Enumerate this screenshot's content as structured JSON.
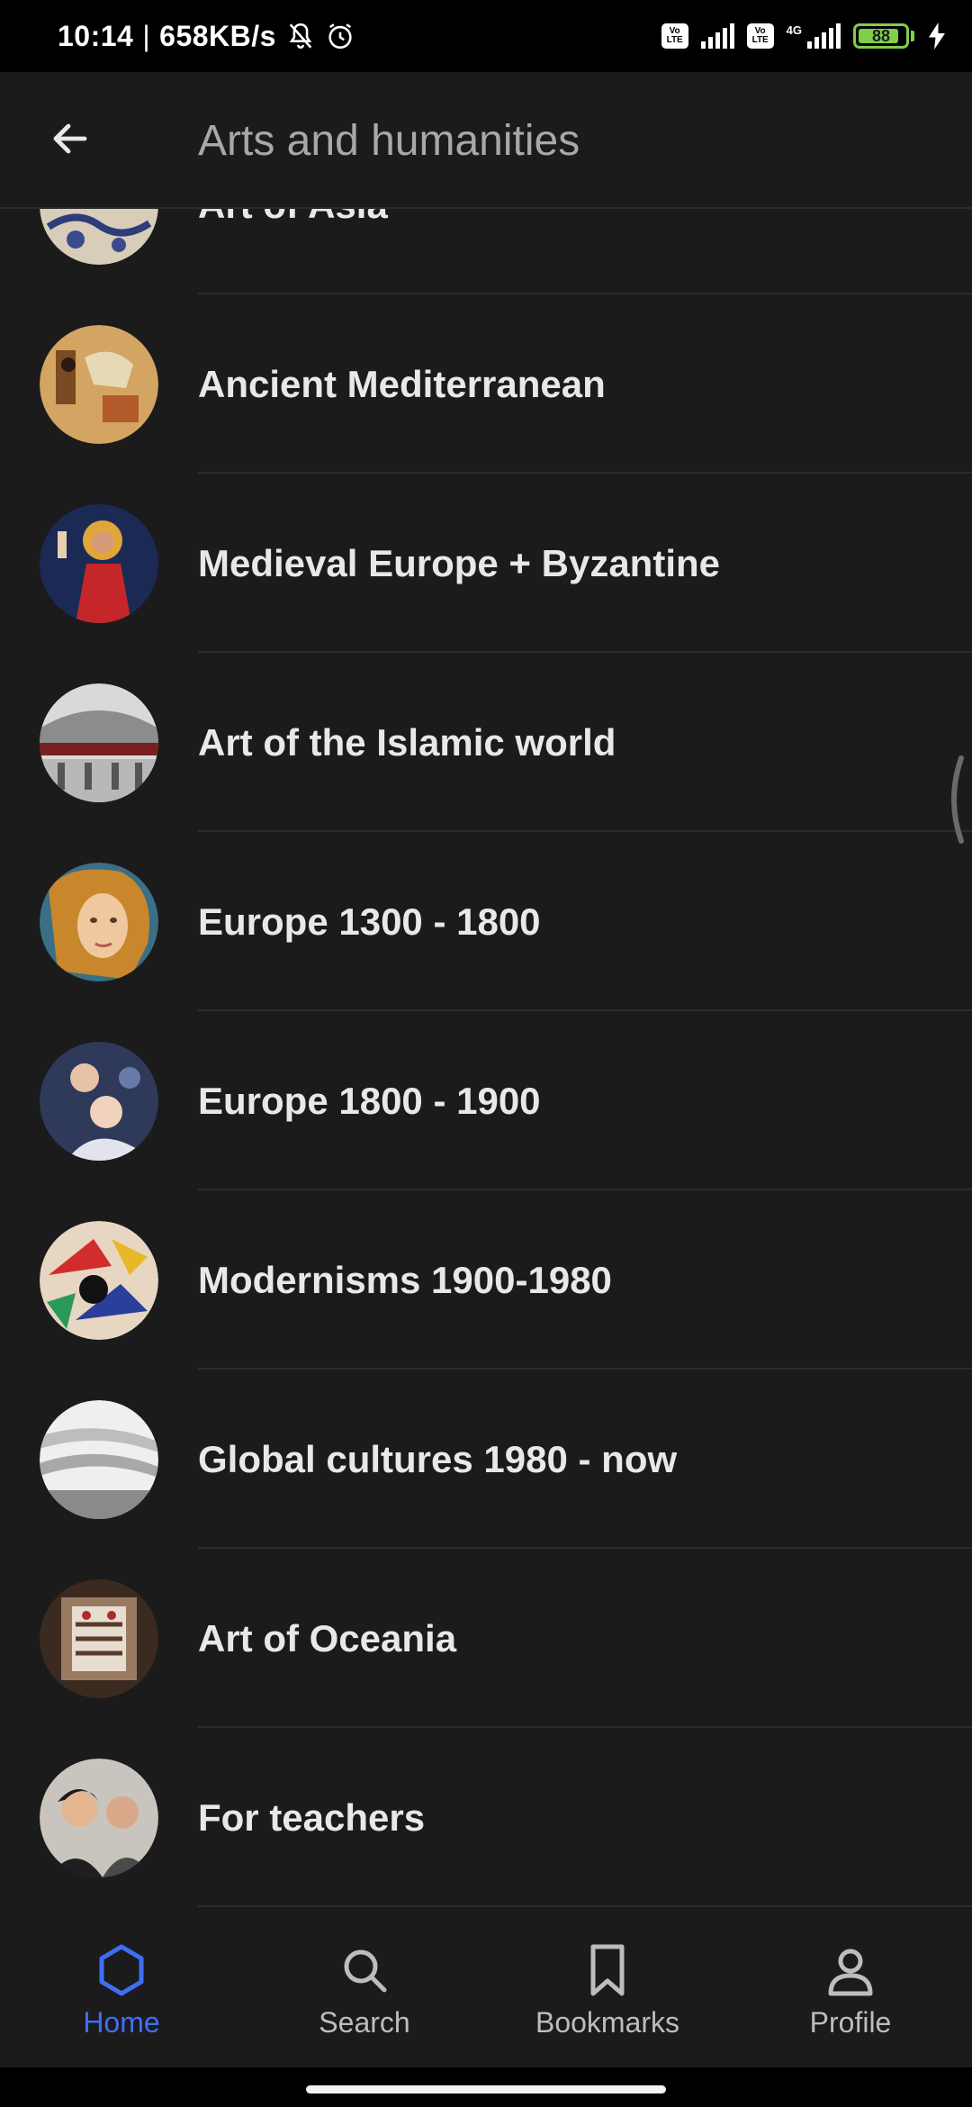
{
  "status_bar": {
    "time": "10:14",
    "speed": "658KB/s",
    "volte1": "Vo LTE",
    "volte2": "Vo LTE",
    "network": "4G",
    "battery": "88",
    "battery_level": 0.88
  },
  "header": {
    "title": "Arts and humanities",
    "back_icon": "arrow-left-icon"
  },
  "list": {
    "items": [
      {
        "label": "Art of Asia"
      },
      {
        "label": "Ancient Mediterranean"
      },
      {
        "label": "Medieval Europe + Byzantine"
      },
      {
        "label": "Art of the Islamic world"
      },
      {
        "label": "Europe 1300 - 1800"
      },
      {
        "label": "Europe 1800 - 1900"
      },
      {
        "label": "Modernisms 1900-1980"
      },
      {
        "label": "Global cultures 1980 - now"
      },
      {
        "label": "Art of Oceania"
      },
      {
        "label": "For teachers"
      }
    ]
  },
  "bottom_nav": {
    "home": "Home",
    "search": "Search",
    "bookmarks": "Bookmarks",
    "profile": "Profile"
  },
  "colors": {
    "background": "#1b1b1c",
    "accent": "#3f6ef6",
    "text": "#e8e8ea",
    "muted": "#a8a8aa"
  }
}
